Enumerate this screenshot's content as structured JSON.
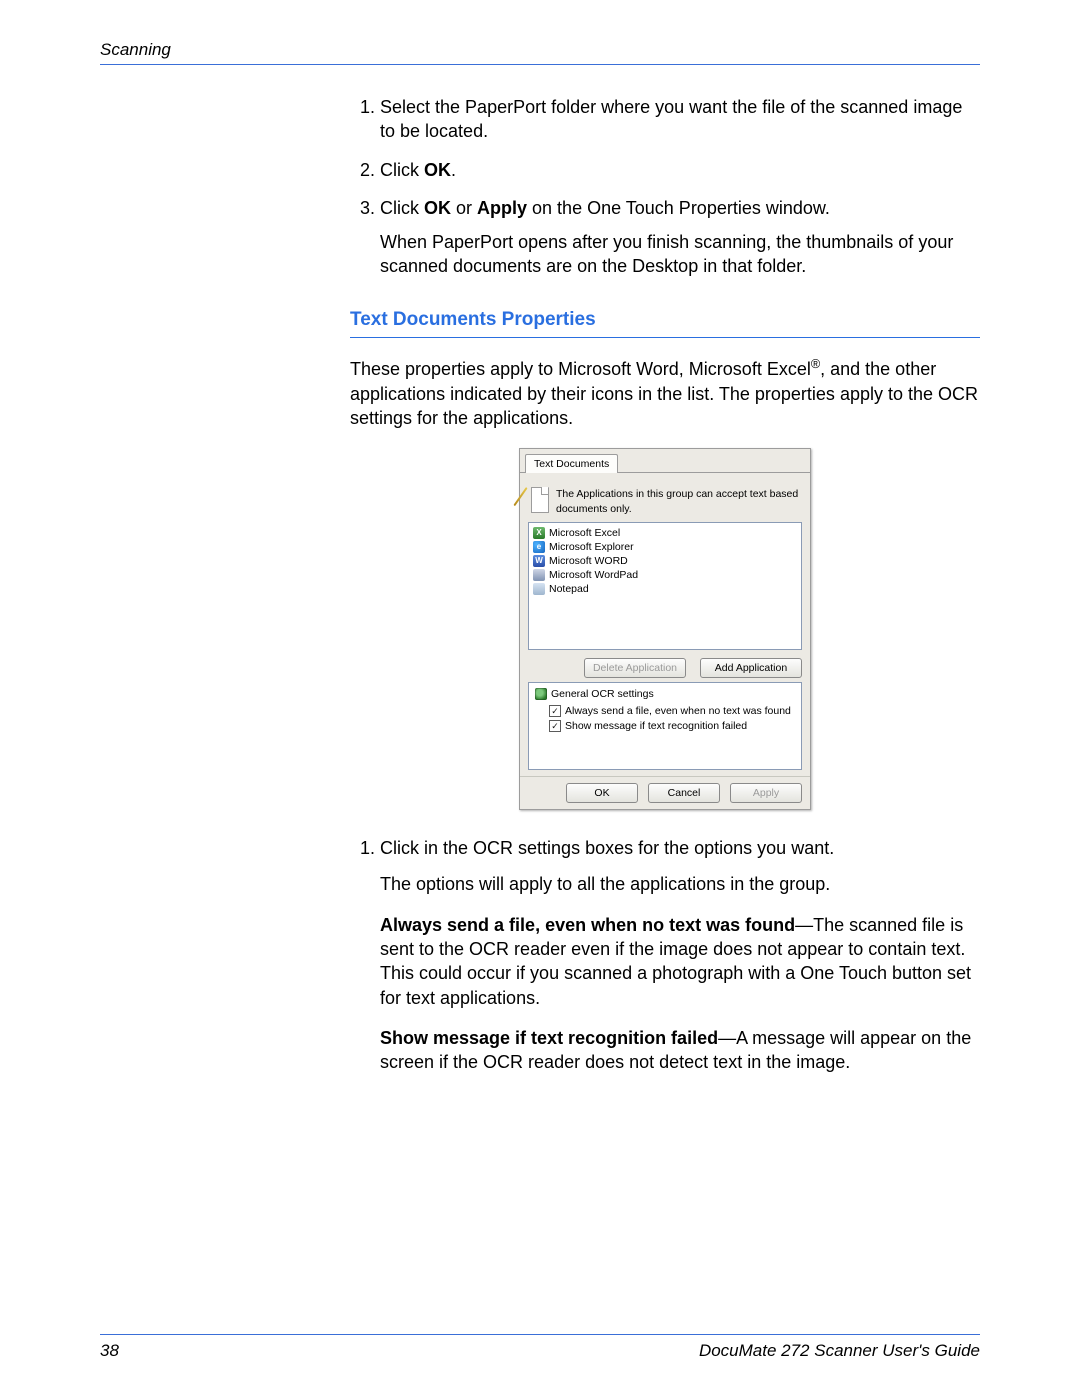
{
  "header": {
    "section": "Scanning"
  },
  "steps1": {
    "item1": "Select the PaperPort folder where you want the file of the scanned image to be located.",
    "item2_prefix": "Click ",
    "item2_ok": "OK",
    "item2_suffix": ".",
    "item3_prefix": "Click ",
    "item3_ok": "OK",
    "item3_mid": " or ",
    "item3_apply": "Apply",
    "item3_suffix": " on the One Touch Properties window.",
    "item3_follow": "When PaperPort opens after you finish scanning, the thumbnails of your scanned documents are on the Desktop in that folder."
  },
  "section_heading": "Text Documents Properties",
  "intro_para_1": "These properties apply to Microsoft Word, Microsoft Excel",
  "intro_para_reg": "®",
  "intro_para_2": ", and the other applications indicated by their icons in the list. The properties apply to the OCR settings for the applications.",
  "dialog": {
    "tab": "Text Documents",
    "info": "The Applications in this group can accept text based documents only.",
    "apps": {
      "a0": "Microsoft Excel",
      "a1": "Microsoft Explorer",
      "a2": "Microsoft WORD",
      "a3": "Microsoft WordPad",
      "a4": "Notepad"
    },
    "delete_btn": "Delete Application",
    "add_btn": "Add Application",
    "ocr_title": "General OCR settings",
    "ocr_opt1": "Always send a file, even when no text was found",
    "ocr_opt2": "Show message if text recognition failed",
    "ok": "OK",
    "cancel": "Cancel",
    "apply": "Apply"
  },
  "steps2": {
    "item1": "Click in the OCR settings boxes for the options you want.",
    "item1_follow": "The options will apply to all the applications in the group."
  },
  "opt1_bold": "Always send a file, even when no text was found",
  "opt1_rest": "—The scanned file is sent to the OCR reader even if the image does not appear to contain text. This could occur if you scanned a photograph with a One Touch button set for text applications.",
  "opt2_bold": "Show message if text recognition failed",
  "opt2_rest": "—A message will appear on the screen if the OCR reader does not detect text in the image.",
  "footer": {
    "page": "38",
    "title": "DocuMate 272 Scanner User's Guide"
  }
}
